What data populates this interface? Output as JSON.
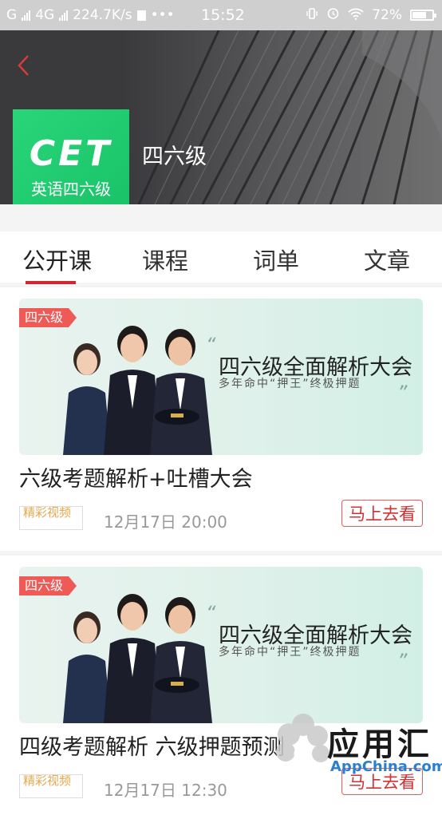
{
  "status_bar": {
    "network_left": "G",
    "network_4g": "4G",
    "speed": "224.7K/s",
    "dots": "•••",
    "time": "15:52",
    "battery": "72%",
    "battery_fraction": 0.72
  },
  "header": {
    "logo_big": "CET",
    "logo_small": "英语四六级",
    "title": "四六级",
    "back_icon": "chevron-left-icon"
  },
  "tabs": [
    {
      "label": "公开课",
      "active": true
    },
    {
      "label": "课程",
      "active": false
    },
    {
      "label": "词单",
      "active": false
    },
    {
      "label": "文章",
      "active": false
    }
  ],
  "cards": [
    {
      "tag": "四六级",
      "banner_title": "四六级全面解析大会",
      "banner_sub": "多年命中“押王”终极押题",
      "title": "六级考题解析+吐槽大会",
      "label": "精彩视频",
      "time": "12月17日 20:00",
      "button": "马上去看"
    },
    {
      "tag": "四六级",
      "banner_title": "四六级全面解析大会",
      "banner_sub": "多年命中“押王”终极押题",
      "title": "四级考题解析 六级押题预测",
      "label": "精彩视频",
      "time": "12月17日 12:30",
      "button": "马上去看"
    }
  ],
  "watermark": {
    "text": "应用汇",
    "url": "AppChina.com"
  },
  "colors": {
    "accent": "#d0262f",
    "logo_green": "#1fca6f",
    "tag_red": "#ee5b56"
  }
}
